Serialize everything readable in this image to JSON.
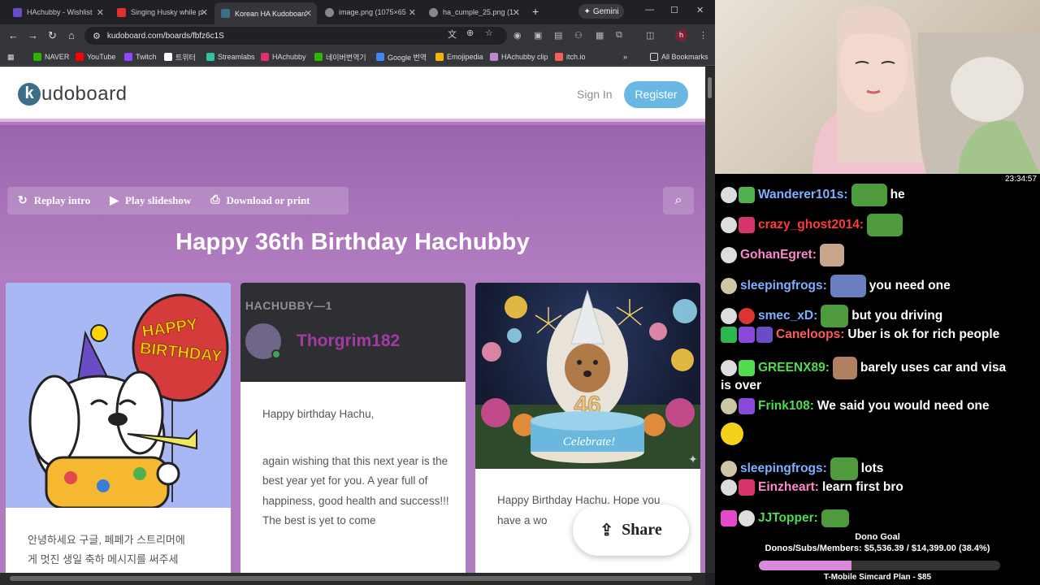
{
  "browser": {
    "tabs": [
      {
        "title": "HAchubby - Wishlist",
        "color": "#6a4cc4"
      },
      {
        "title": "Singing Husky while p",
        "color": "#e03030"
      },
      {
        "title": "Korean HA Kudoboard",
        "color": "#3b6e88"
      },
      {
        "title": "image.png (1075×65",
        "color": "#888888"
      },
      {
        "title": "ha_cumple_25.png (1",
        "color": "#888888"
      }
    ],
    "gemini_label": "Gemini",
    "url": "kudoboard.com/boards/fbfz6c1S",
    "profile_initial": "h",
    "bookmarks": [
      {
        "label": "NAVER",
        "color": "#2db400"
      },
      {
        "label": "YouTube",
        "color": "#ff0000"
      },
      {
        "label": "Twitch",
        "color": "#9146ff"
      },
      {
        "label": "트위터",
        "color": "#ffffff"
      },
      {
        "label": "Streamlabs",
        "color": "#31c3a2"
      },
      {
        "label": "HAchubby",
        "color": "#e1306c"
      },
      {
        "label": "네이버번역기",
        "color": "#2db400"
      },
      {
        "label": "Google 번역",
        "color": "#4285f4"
      },
      {
        "label": "Emojipedia",
        "color": "#f7b500"
      },
      {
        "label": "HAchubby clip",
        "color": "#bb88cc"
      },
      {
        "label": "itch.io",
        "color": "#fa5c5c"
      }
    ],
    "all_bookmarks": "All Bookmarks"
  },
  "kudoboard": {
    "logo_k": "k",
    "logo_rest": "udoboard",
    "sign_in": "Sign In",
    "register": "Register",
    "actions": {
      "replay": "Replay intro",
      "slideshow": "Play slideshow",
      "download": "Download or print"
    },
    "board_title": "Happy 36th Birthday Hachubby",
    "cards": [
      {
        "image_text_line1": "HAPPY",
        "image_text_line2": "BIRTHDAY",
        "text_line1": "안녕하세요 구글, 페페가 스트리머에",
        "text_line2": "게 멋진 생일 축하 메시지를 써주세"
      },
      {
        "header_label": "HACHUBBY—1",
        "author": "Thorgrim182",
        "text_line1": "Happy birthday Hachu,",
        "text_line2": "again wishing that this next year is the best year yet for you. A year full of happiness, good health and success!!! The best is yet to come"
      },
      {
        "cake_number": "46",
        "cake_text": "Celebrate!",
        "text": "Happy Birthday Hachu. Hope you have a wo"
      }
    ],
    "share": "Share"
  },
  "stream": {
    "clock": "23:34:57",
    "chat": [
      {
        "user": "Wanderer101s:",
        "color": "#7fb0ff",
        "text": "he"
      },
      {
        "user": "crazy_ghost2014:",
        "color": "#ff3b3b",
        "text": ""
      },
      {
        "user": "GohanEgret:",
        "color": "#ff88c8",
        "text": ""
      },
      {
        "user": "sleepingfrogs:",
        "color": "#7fb0ff",
        "text": "you need one"
      },
      {
        "user": "smec_xD:",
        "color": "#7fb0ff",
        "text": "but you driving"
      },
      {
        "user": "Caneloops:",
        "color": "#ff5a5a",
        "text": "Uber is ok for rich people"
      },
      {
        "user": "GREENX89:",
        "color": "#4fdc4f",
        "text": "barely uses car and visa"
      },
      {
        "user": "",
        "color": "#ffffff",
        "text": "is over"
      },
      {
        "user": "Frink108:",
        "color": "#4fdc4f",
        "text": "We said you would need one"
      },
      {
        "user": "sleepingfrogs:",
        "color": "#7fb0ff",
        "text": "lots"
      },
      {
        "user": "Einzheart:",
        "color": "#ff88c8",
        "text": "learn first bro"
      },
      {
        "user": "JJTopper:",
        "color": "#4fdc4f",
        "text": ""
      }
    ],
    "goal_title": "Dono Goal",
    "goal_line": "Donos/Subs/Members: $5,536.39 / $14,399.00 (38.4%)",
    "goal_progress": 0.384,
    "goal_footer": "T-Mobile Simcard Plan - $85"
  }
}
